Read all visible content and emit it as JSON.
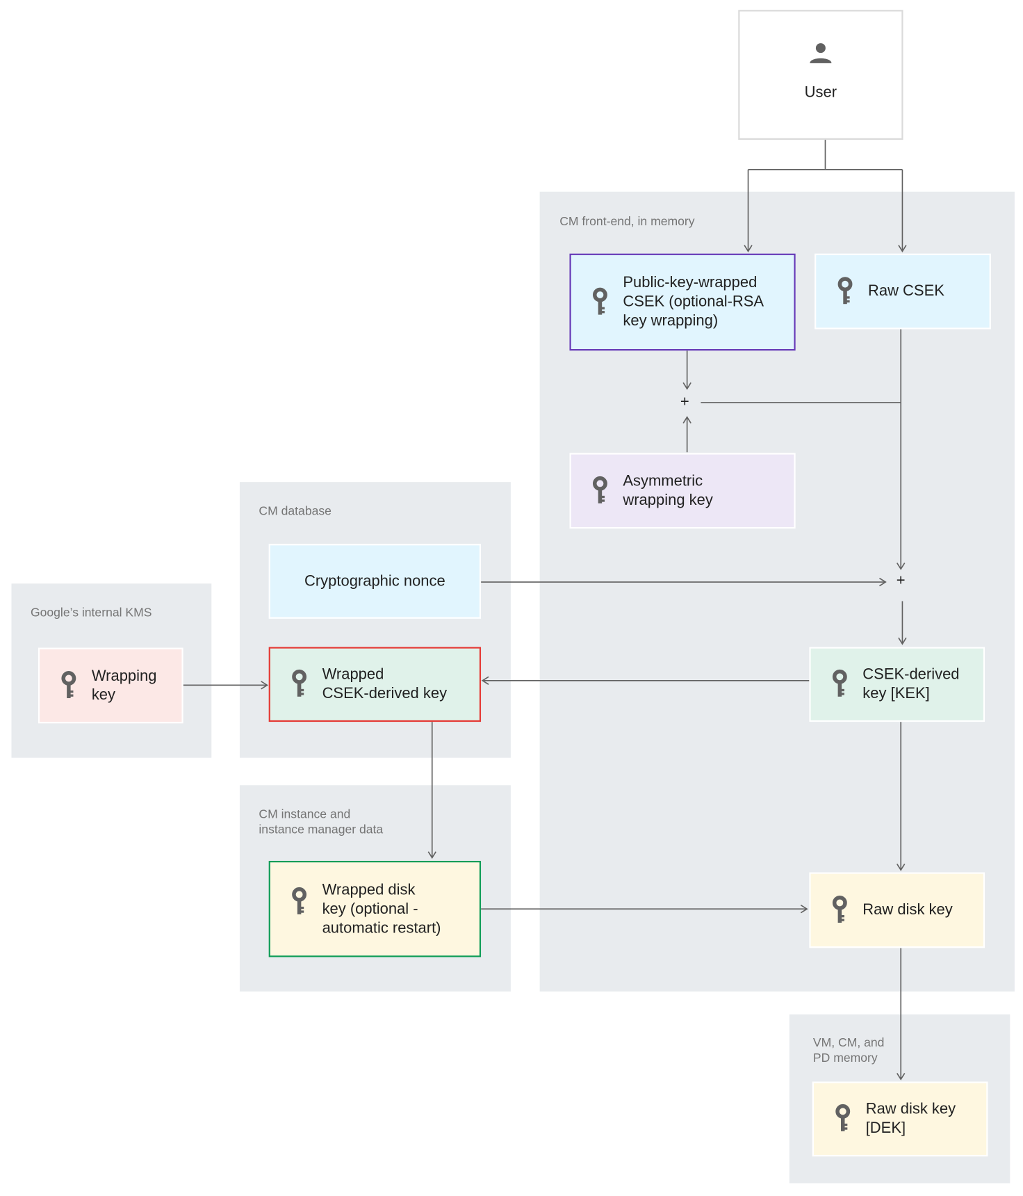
{
  "colors": {
    "region": "#e8ebee",
    "blue": "#e1f5fe",
    "purple_fill": "#ede7f6",
    "purple_border": "#673ab7",
    "green": "#e0f2ea",
    "red_border": "#e53935",
    "yellow": "#fef7e0",
    "green_border": "#0f9d58",
    "pink": "#fce8e6",
    "line": "#616161"
  },
  "user": {
    "label": "User",
    "icon": "person-icon"
  },
  "regions": {
    "frontend": "CM front-end, in memory",
    "database": "CM database",
    "kms": "Google’s internal KMS",
    "instance": "CM instance and\ninstance manager data",
    "vm": "VM, CM, and\nPD memory"
  },
  "boxes": {
    "public_wrapped": "Public-key-wrapped\nCSEK (optional-RSA\nkey wrapping)",
    "raw_csek": "Raw CSEK",
    "asymmetric": "Asymmetric\nwrapping key",
    "nonce": "Cryptographic nonce",
    "kek": "CSEK-derived\nkey [KEK]",
    "wrapped_kek": "Wrapped\nCSEK-derived key",
    "wrapping_key": "Wrapping\nkey",
    "wrapped_disk": "Wrapped disk\nkey (optional -\nautomatic restart)",
    "raw_disk": "Raw disk key",
    "dek": "Raw disk key\n[DEK]"
  },
  "operators": {
    "plus1": "+",
    "plus2": "+"
  }
}
